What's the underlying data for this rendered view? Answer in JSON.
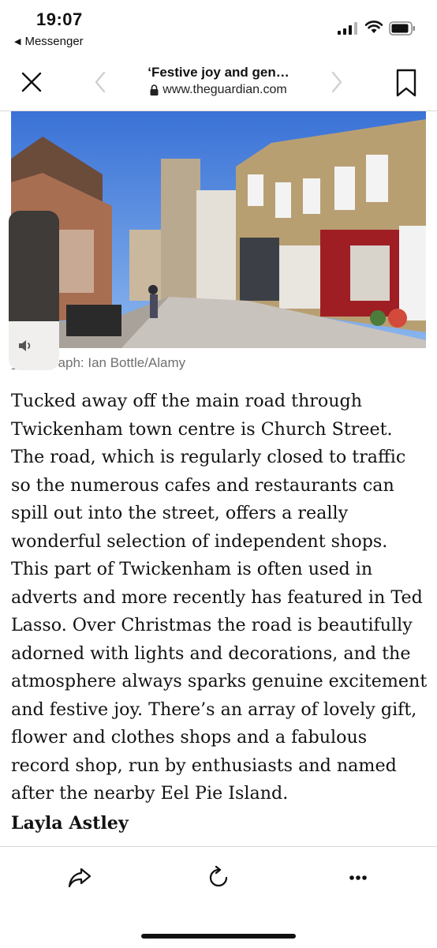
{
  "status_bar": {
    "time": "19:07",
    "back_app": "Messenger",
    "icons": [
      "cellular-signal-icon",
      "wifi-icon",
      "battery-icon"
    ]
  },
  "browser": {
    "title": "‘Festive joy and gen…",
    "url": "www.theguardian.com",
    "icons": [
      "close-icon",
      "back-chevron-icon",
      "forward-chevron-icon",
      "lock-icon",
      "bookmark-icon"
    ]
  },
  "photo": {
    "caption": "Photograph: Ian Bottle/Alamy"
  },
  "article": {
    "paragraph": "Tucked away off the main road through Twickenham town centre is Church Street. The road, which is regularly closed to traffic so the numerous cafes and restaurants can spill out into the street, offers a really wonderful selection of independent shops. This part of Twickenham is often used in adverts and more recently has featured in Ted Lasso. Over Christmas the road is beautifully adorned with lights and decorations, and the atmosphere always sparks genuine excitement and festive joy. There’s an array of lovely gift, flower and clothes shops and a fabulous record shop, run by enthusiasts and named after the nearby Eel Pie Island.",
    "author": "Layla Astley"
  },
  "toolbar": {
    "icons": [
      "share-icon",
      "reload-icon",
      "more-icon"
    ]
  },
  "colors": {
    "text": "#121212",
    "caption": "#707070",
    "divider": "#d8d8d8",
    "volume_dark": "#3e3b39",
    "volume_light": "#f0efed"
  }
}
